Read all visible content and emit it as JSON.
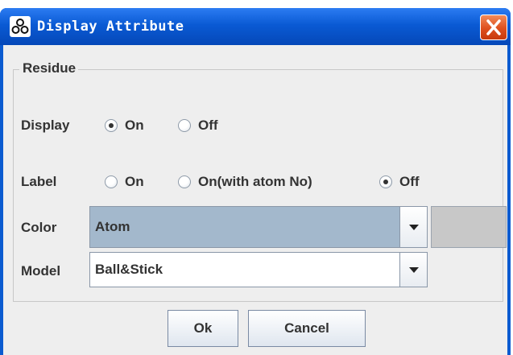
{
  "window": {
    "title": "Display Attribute"
  },
  "residue": {
    "group_title": "Residue",
    "display": {
      "label": "Display",
      "options": [
        {
          "label": "On",
          "checked": true
        },
        {
          "label": "Off",
          "checked": false
        }
      ]
    },
    "label_row": {
      "label": "Label",
      "options": [
        {
          "label": "On",
          "checked": false
        },
        {
          "label": "On(with atom No)",
          "checked": false
        },
        {
          "label": "Off",
          "checked": true
        }
      ]
    },
    "color": {
      "label": "Color",
      "selected": "Atom",
      "swatch": "#c8c8c8"
    },
    "model": {
      "label": "Model",
      "selected": "Ball&Stick"
    }
  },
  "buttons": {
    "ok": "Ok",
    "cancel": "Cancel"
  },
  "colors": {
    "title_bar": "#0a5ad4",
    "close_button": "#de4f1d",
    "dialog_bg": "#eeeeee",
    "combo_selected_bg": "#a3b8cc",
    "combo_bg": "#ffffff"
  }
}
